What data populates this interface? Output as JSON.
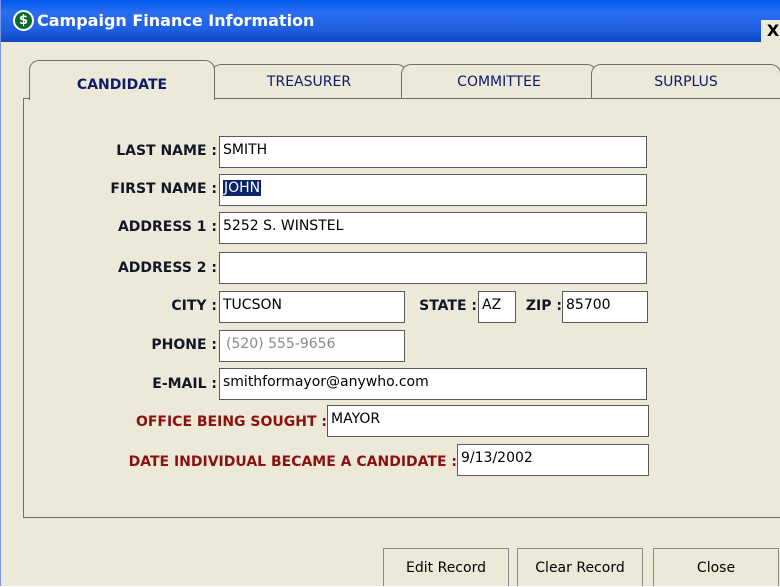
{
  "window": {
    "title": "Campaign Finance Information",
    "close_glyph": "X",
    "app_icon": "dollar-icon",
    "icon_glyph": "$"
  },
  "tabs": [
    {
      "label": "CANDIDATE",
      "active": true
    },
    {
      "label": "TREASURER",
      "active": false
    },
    {
      "label": "COMMITTEE",
      "active": false
    },
    {
      "label": "SURPLUS",
      "active": false
    }
  ],
  "form": {
    "last_name": {
      "label": "LAST NAME :",
      "value": "SMITH"
    },
    "first_name": {
      "label": "FIRST NAME :",
      "value": "JOHN",
      "selected": true
    },
    "address1": {
      "label": "ADDRESS 1 :",
      "value": "5252 S. WINSTEL"
    },
    "address2": {
      "label": "ADDRESS 2 :",
      "value": ""
    },
    "city": {
      "label": "CITY :",
      "value": "TUCSON"
    },
    "state": {
      "label": "STATE :",
      "value": "AZ"
    },
    "zip": {
      "label": "ZIP :",
      "value": "85700"
    },
    "phone": {
      "label": "PHONE :",
      "value": "(520) 555-9656"
    },
    "email": {
      "label": "E-MAIL :",
      "value": "smithformayor@anywho.com"
    },
    "office": {
      "label": "OFFICE BEING SOUGHT :",
      "value": "MAYOR"
    },
    "date_candidate": {
      "label": "DATE INDIVIDUAL BECAME A CANDIDATE :",
      "value": "9/13/2002"
    }
  },
  "buttons": {
    "edit": "Edit Record",
    "clear": "Clear Record",
    "close": "Close"
  },
  "colors": {
    "titlebar": "#0a46c8",
    "accent_label": "#8b1010",
    "tab_text": "#0c1c6b",
    "selection": "#0a246a"
  }
}
